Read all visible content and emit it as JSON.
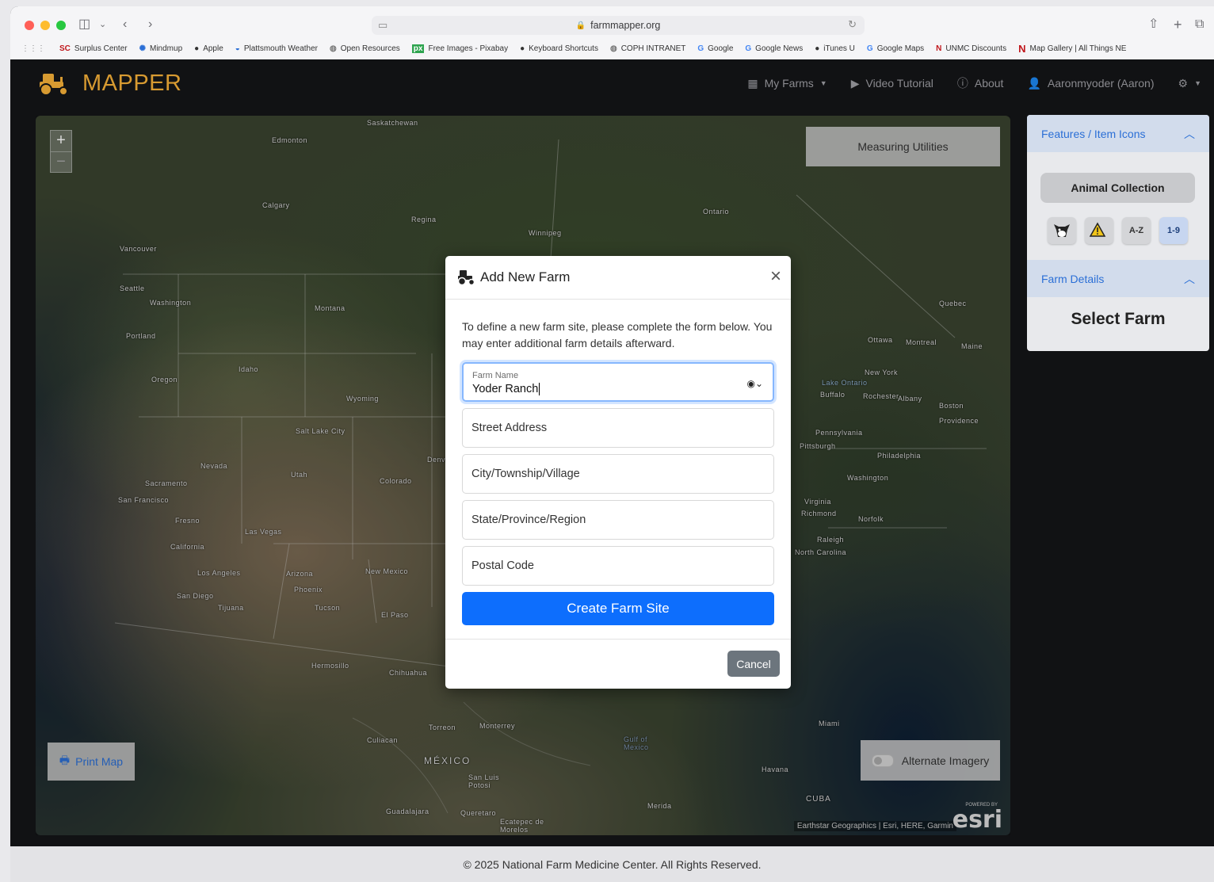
{
  "browser": {
    "url": "farmmapper.org",
    "bookmarks": [
      {
        "icon": "SC",
        "label": "Surplus Center"
      },
      {
        "icon": "✺",
        "label": "Mindmup"
      },
      {
        "icon": "",
        "label": "Apple"
      },
      {
        "icon": "◒",
        "label": "Plattsmouth Weather"
      },
      {
        "icon": "◍",
        "label": "Open Resources"
      },
      {
        "icon": "px",
        "label": "Free Images - Pixabay"
      },
      {
        "icon": "",
        "label": "Keyboard Shortcuts"
      },
      {
        "icon": "◍",
        "label": "COPH INTRANET"
      },
      {
        "icon": "G",
        "label": "Google"
      },
      {
        "icon": "G",
        "label": "Google News"
      },
      {
        "icon": "",
        "label": "iTunes U"
      },
      {
        "icon": "G",
        "label": "Google Maps"
      },
      {
        "icon": "N",
        "label": "UNMC Discounts"
      },
      {
        "icon": "N",
        "label": "Map Gallery | All Things NE"
      }
    ]
  },
  "app": {
    "logo_text": "MAPPER",
    "nav": {
      "my_farms": "My Farms",
      "video_tutorial": "Video Tutorial",
      "about": "About",
      "user": "Aaronmyoder (Aaron)"
    }
  },
  "map": {
    "measuring_utilities": "Measuring Utilities",
    "print_map": "Print Map",
    "alternate_imagery": "Alternate Imagery",
    "attribution": "Earthstar Geographics | Esri, HERE, Garmin",
    "esri_powered": "POWERED BY",
    "esri_logo": "esri",
    "zoom_in": "+",
    "zoom_out": "−",
    "labels": [
      "Saskatchewan",
      "Edmonton",
      "Calgary",
      "Regina",
      "Winnipeg",
      "Ontario",
      "Vancouver",
      "Seattle",
      "Washington",
      "Portland",
      "Oregon",
      "Montana",
      "Idaho",
      "Wyoming",
      "Nevada",
      "Utah",
      "Salt Lake City",
      "Colorado",
      "Denver",
      "Sacramento",
      "San Francisco",
      "Fresno",
      "California",
      "Las Vegas",
      "Los Angeles",
      "San Diego",
      "Tijuana",
      "Arizona",
      "Phoenix",
      "Tucson",
      "New Mexico",
      "El Paso",
      "Hermosillo",
      "Chihuahua",
      "Culiacan",
      "MÉXICO",
      "Torreon",
      "Monterrey",
      "San Luis Potosi",
      "Guadalajara",
      "Queretaro",
      "Ecatepec de Morelos",
      "Merida",
      "Gulf of Mexico",
      "Havana",
      "CUBA",
      "Miami",
      "Quebec",
      "Ottawa",
      "Montreal",
      "Maine",
      "New York",
      "Buffalo",
      "Rochester",
      "Albany",
      "Boston",
      "Providence",
      "Pennsylvania",
      "Pittsburgh",
      "Philadelphia",
      "Washington",
      "Virginia",
      "Richmond",
      "Norfolk",
      "Raleigh",
      "North Carolina",
      "Lake Ontario"
    ]
  },
  "modal": {
    "title": "Add New Farm",
    "close": "×",
    "description": "To define a new farm site, please complete the form below. You may enter additional farm details afterward.",
    "farm_name_label": "Farm Name",
    "farm_name_value": "Yoder Ranch",
    "street_placeholder": "Street Address",
    "city_placeholder": "City/Township/Village",
    "state_placeholder": "State/Province/Region",
    "postal_placeholder": "Postal Code",
    "create_button": "Create Farm Site",
    "cancel_button": "Cancel"
  },
  "panel": {
    "features_header": "Features / Item Icons",
    "animal_collection": "Animal Collection",
    "icon_az": "A-Z",
    "icon_19": "1-9",
    "farm_details_header": "Farm Details",
    "select_farm": "Select Farm"
  },
  "footer": {
    "text": "© 2025 National Farm Medicine Center. All Rights Reserved."
  },
  "colors": {
    "brand": "#d79a31",
    "primary": "#0d6efd",
    "link": "#2b6fd6"
  }
}
